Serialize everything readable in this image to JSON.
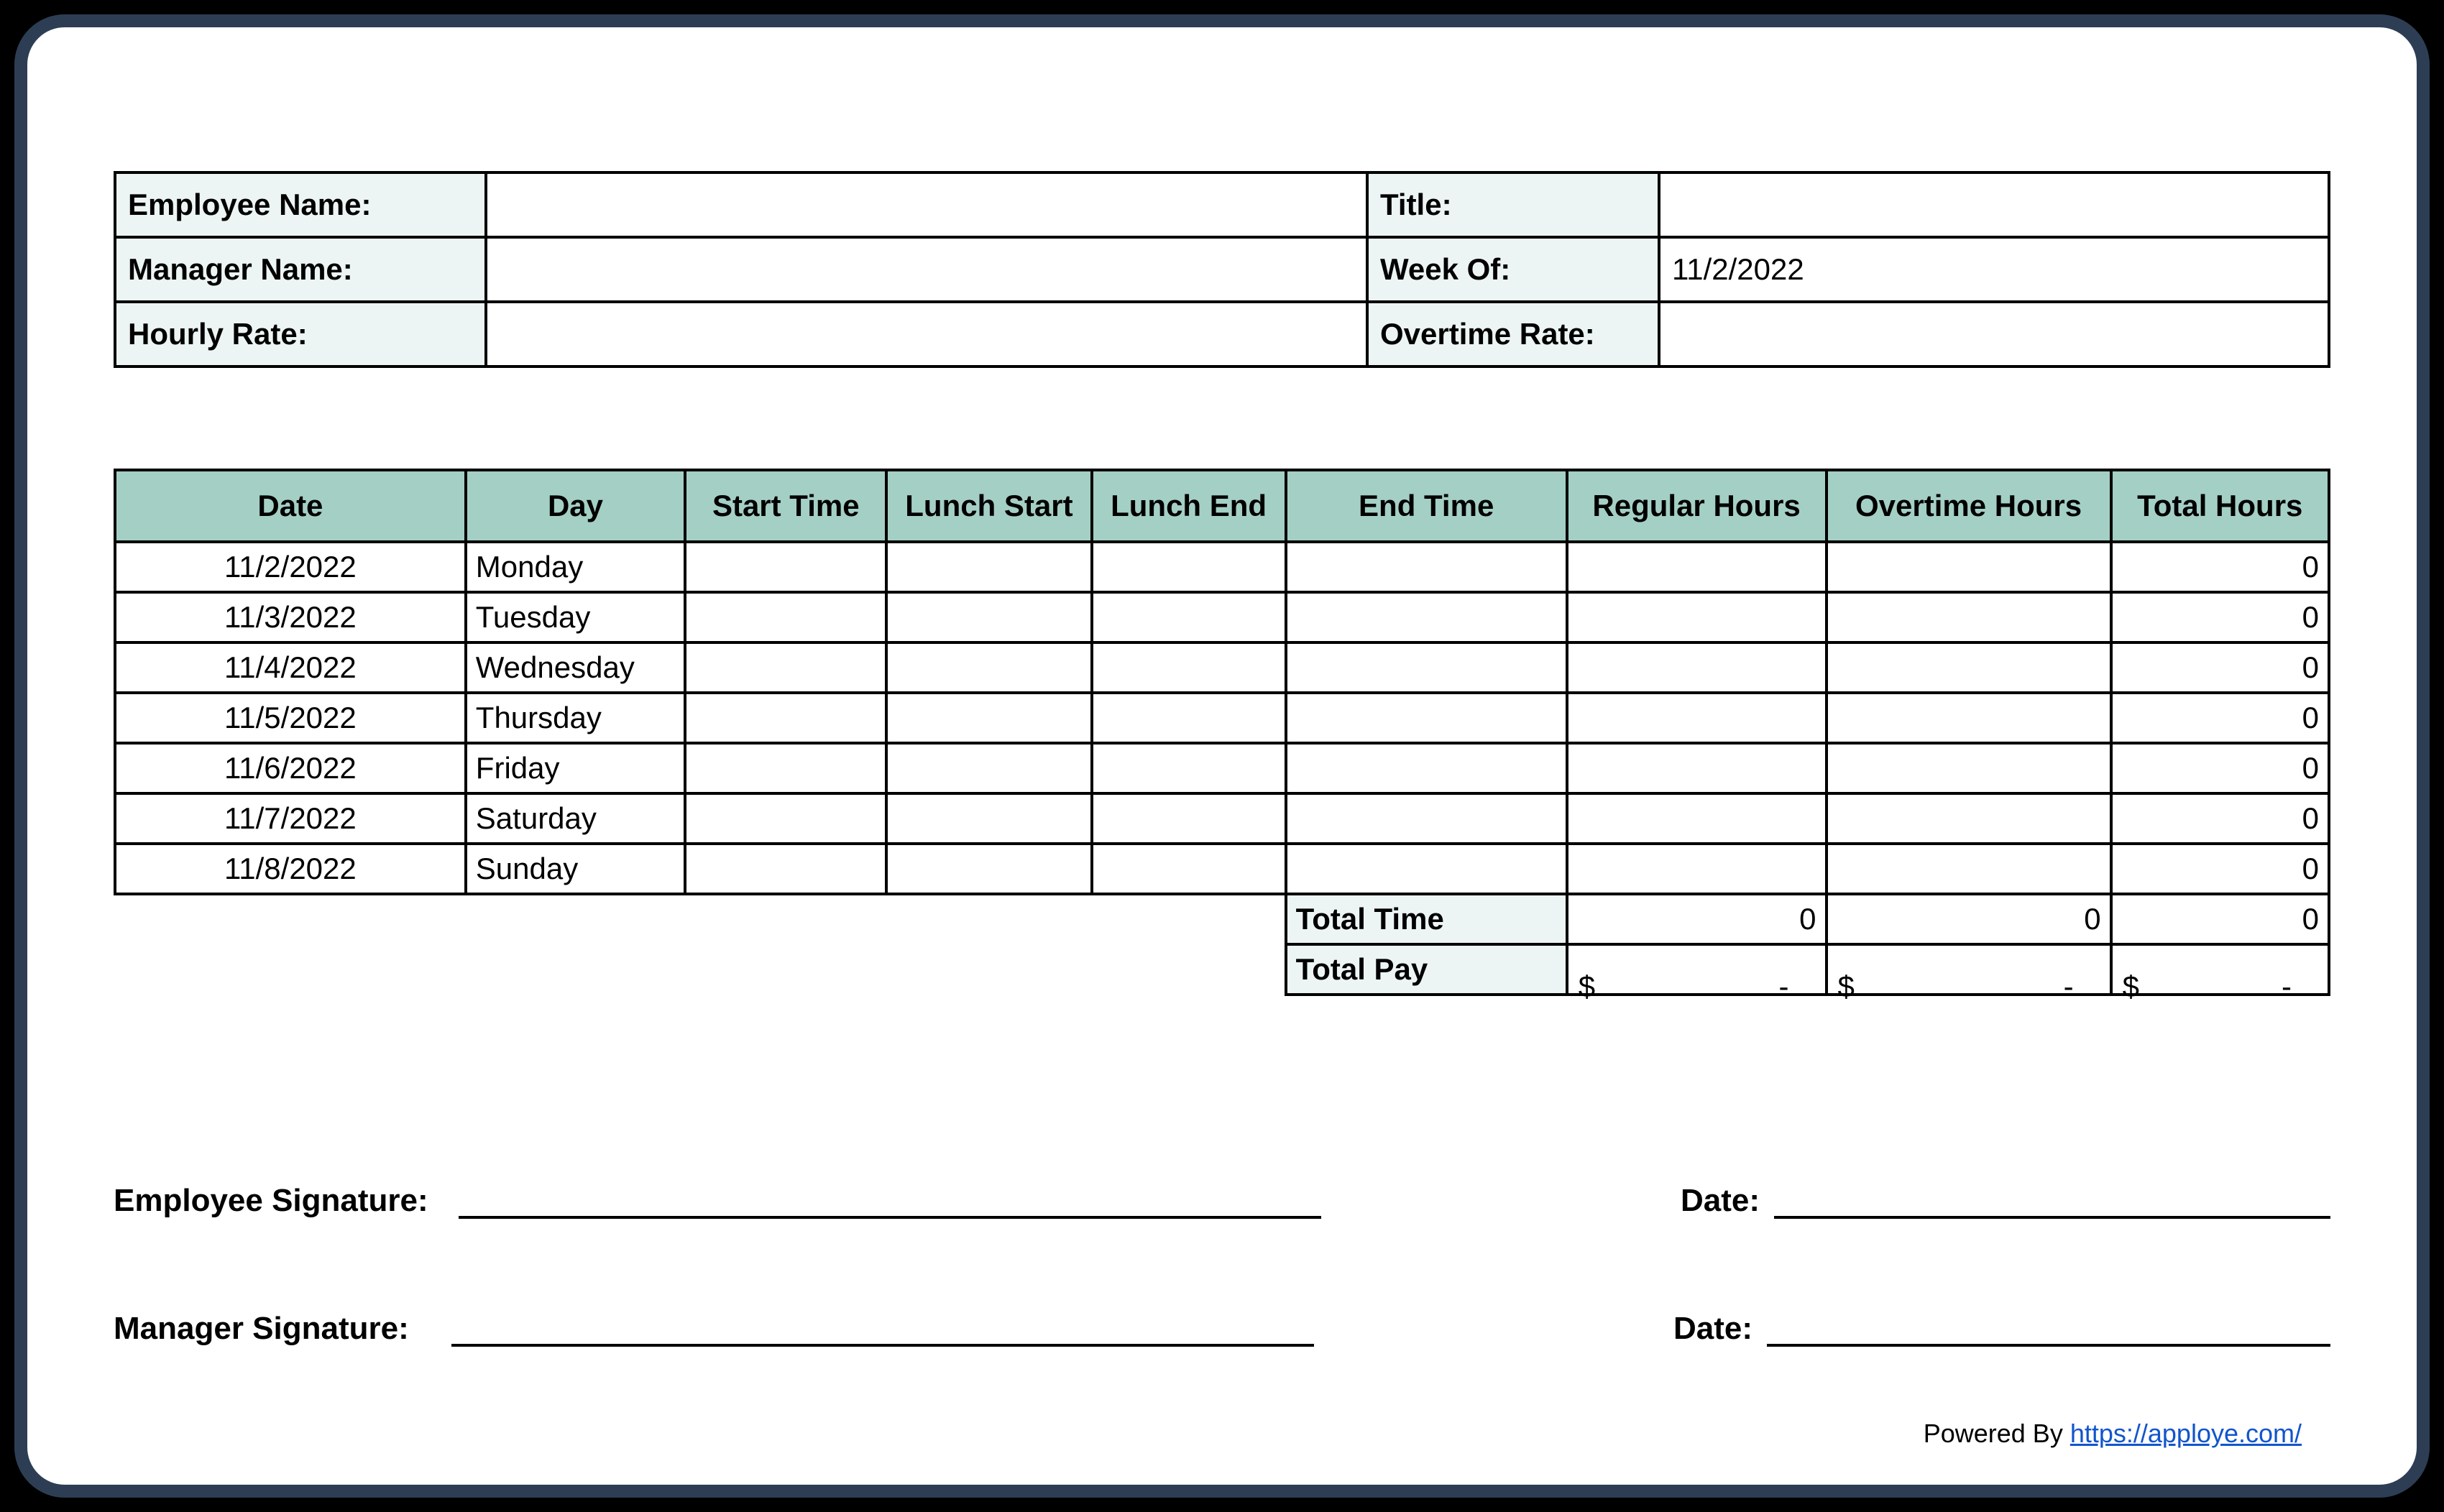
{
  "info": {
    "employeeNameLabel": "Employee Name:",
    "employeeNameValue": "",
    "titleLabel": "Title:",
    "titleValue": "",
    "managerNameLabel": "Manager Name:",
    "managerNameValue": "",
    "weekOfLabel": "Week Of:",
    "weekOfValue": "11/2/2022",
    "hourlyRateLabel": "Hourly Rate:",
    "hourlyRateValue": "",
    "overtimeRateLabel": "Overtime Rate:",
    "overtimeRateValue": ""
  },
  "headers": {
    "date": "Date",
    "day": "Day",
    "start": "Start Time",
    "lunchStart": "Lunch Start",
    "lunchEnd": "Lunch End",
    "end": "End Time",
    "regular": "Regular Hours",
    "overtime": "Overtime Hours",
    "total": "Total Hours"
  },
  "rows": [
    {
      "date": "11/2/2022",
      "day": "Monday",
      "start": "",
      "lunchStart": "",
      "lunchEnd": "",
      "end": "",
      "regular": "",
      "overtime": "",
      "total": "0"
    },
    {
      "date": "11/3/2022",
      "day": "Tuesday",
      "start": "",
      "lunchStart": "",
      "lunchEnd": "",
      "end": "",
      "regular": "",
      "overtime": "",
      "total": "0"
    },
    {
      "date": "11/4/2022",
      "day": "Wednesday",
      "start": "",
      "lunchStart": "",
      "lunchEnd": "",
      "end": "",
      "regular": "",
      "overtime": "",
      "total": "0"
    },
    {
      "date": "11/5/2022",
      "day": "Thursday",
      "start": "",
      "lunchStart": "",
      "lunchEnd": "",
      "end": "",
      "regular": "",
      "overtime": "",
      "total": "0"
    },
    {
      "date": "11/6/2022",
      "day": "Friday",
      "start": "",
      "lunchStart": "",
      "lunchEnd": "",
      "end": "",
      "regular": "",
      "overtime": "",
      "total": "0"
    },
    {
      "date": "11/7/2022",
      "day": "Saturday",
      "start": "",
      "lunchStart": "",
      "lunchEnd": "",
      "end": "",
      "regular": "",
      "overtime": "",
      "total": "0"
    },
    {
      "date": "11/8/2022",
      "day": "Sunday",
      "start": "",
      "lunchStart": "",
      "lunchEnd": "",
      "end": "",
      "regular": "",
      "overtime": "",
      "total": "0"
    }
  ],
  "summary": {
    "totalTimeLabel": "Total Time",
    "totalTimeRegular": "0",
    "totalTimeOvertime": "0",
    "totalTimeTotal": "0",
    "totalPayLabel": "Total Pay",
    "currencySymbol": "$",
    "dash": "-"
  },
  "signatures": {
    "employeeLabel": "Employee Signature:",
    "managerLabel": "Manager Signature:",
    "dateLabel": "Date:"
  },
  "footer": {
    "prefix": "Powered By ",
    "linkText": "https://apploye.com/"
  }
}
